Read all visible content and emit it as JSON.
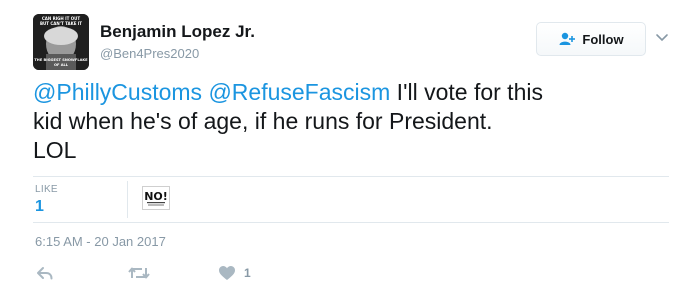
{
  "author": {
    "name": "Benjamin Lopez Jr.",
    "handle": "@Ben4Pres2020",
    "avatar_text": {
      "top_line_1": "CAN RIGH IT OUT",
      "top_line_2": "BUT CAN'T TAKE IT",
      "bottom_line_1": "THE BIGGEST SNOWFLAKE",
      "bottom_line_2": "OF ALL"
    }
  },
  "follow": {
    "label": "Follow",
    "icon": "add-user-icon"
  },
  "menu": {
    "icon": "chevron-down-icon"
  },
  "tweet": {
    "mention_1": "@PhillyCustoms",
    "mention_2": "@RefuseFascism",
    "text_line_1": " I'll vote for this",
    "text_line_2": "kid when he's of age, if he runs for President.",
    "text_line_3": "LOL"
  },
  "stats": {
    "likes_label": "LIKE",
    "likes_count": "1",
    "liker_avatar_text": "NO!"
  },
  "timestamp": "6:15 AM - 20 Jan 2017",
  "actions": {
    "reply_icon": "reply-icon",
    "retweet_icon": "retweet-icon",
    "like_icon": "heart-icon",
    "like_count": "1"
  },
  "colors": {
    "text": "#14171a",
    "muted": "#8899a6",
    "link": "#1b95e0",
    "border": "#e1e8ed",
    "icon": "#aab8c2"
  }
}
